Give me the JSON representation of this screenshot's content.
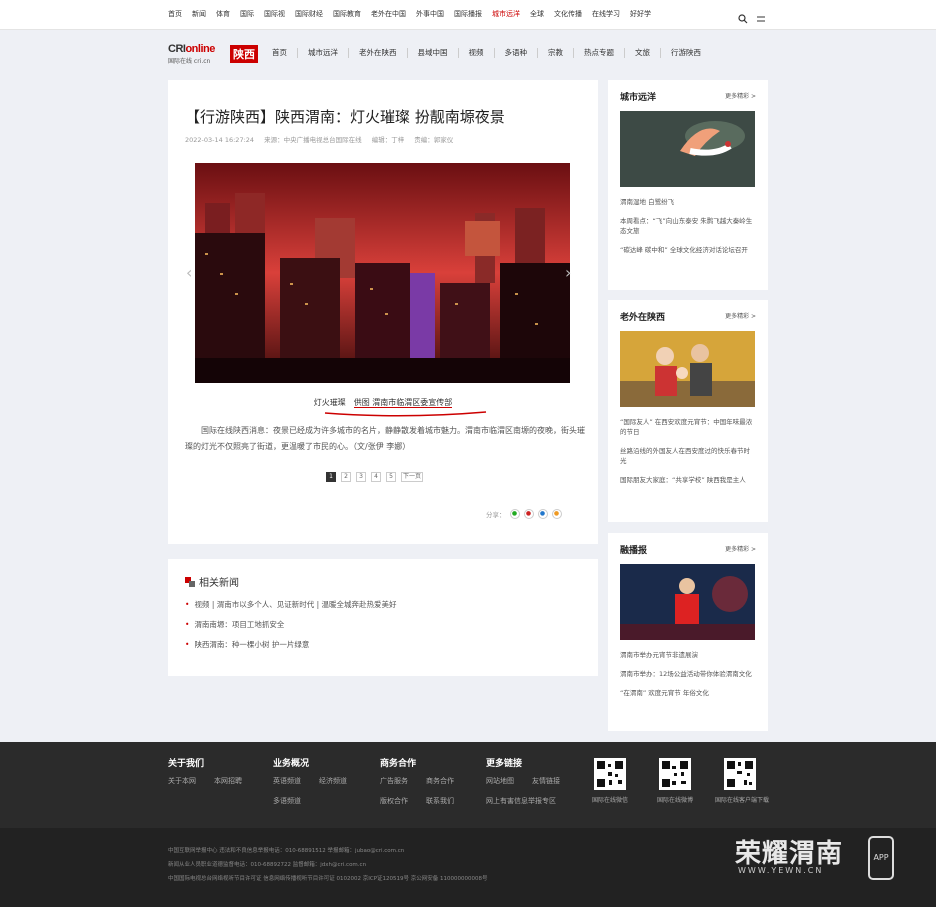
{
  "topnav": [
    "首页",
    "新闻",
    "体育",
    "国际",
    "国际视",
    " 国际财经",
    "国际教育",
    "老外在中国",
    "外事中国",
    "国际播报",
    "城市远洋",
    "全球",
    " 文化传播",
    "在线学习",
    "好好学"
  ],
  "topnav_highlight": 10,
  "logo": {
    "brand_a": "CRI",
    "brand_b": "online",
    "sub": "国际在线 cri.cn",
    "tag": "陕西"
  },
  "mainnav": [
    "首页",
    "城市远洋",
    "老外在陕西",
    "县域中国",
    "视频",
    "多语种",
    "宗教",
    "热点专题",
    "文旅",
    "行游陕西"
  ],
  "article": {
    "title": "【行游陕西】陕西渭南：灯火璀璨 扮靓南塬夜景",
    "date": "2022-03-14 16:27:24",
    "source": "来源：中央广播电视总台国际在线",
    "editor": "编辑：丁梓",
    "reviewer": "责编：郭家仪",
    "caption_prefix": "灯火璀璨",
    "caption_link": "供图 渭南市临渭区委宣传部",
    "body": "国际在线陕西消息：夜景已经成为许多城市的名片，静静散发着城市魅力。渭南市临渭区南塬的夜晚，街头璀璨的灯光不仅照亮了街道，更温暖了市民的心。（文/张伊 李娜）",
    "pages": [
      "1",
      "2",
      "3",
      "4",
      "5",
      "下一页"
    ],
    "share_label": "分享："
  },
  "related": {
    "title": "相关新闻",
    "items": [
      "视频 | 渭南市以多个人、见证新时代 | 温暖全城奔赴热爱美好",
      "渭南南塬：项目工地抓安全",
      "陕西渭南：种一棵小树 护一片绿意"
    ]
  },
  "sidebar": [
    {
      "title": "城市远洋",
      "more": "更多精彩 >",
      "items": [
        "渭南湿地 白鹭纷飞",
        "本周看点：“飞”向山东泰安 朱鹮飞越大秦岭生态文旅",
        "“碳达峰 碳中和” 全球文化经济对话论坛召开"
      ]
    },
    {
      "title": "老外在陕西",
      "more": "更多精彩 >",
      "items": [
        "“国际友人” 在西安欢度元宵节：中国年味最浓的节日",
        "丝路沿线的外国友人在西安度过的快乐春节时光",
        "国际朋友大家庭：“共享学校” 陕西我是主人"
      ]
    },
    {
      "title": "融播报",
      "more": "更多精彩 >",
      "items": [
        "渭南市举办元宵节非遗展演",
        "渭南市举办：12场公益活动带你体验渭南文化",
        "“在渭南” 欢度元宵节 年俗文化"
      ]
    }
  ],
  "footer": {
    "about": {
      "title": "关于我们",
      "links": [
        "关于本网",
        "本网招聘"
      ]
    },
    "biz": {
      "title": "业务概况",
      "links": [
        "英语频道",
        "经济频道",
        "多语频道"
      ]
    },
    "coop": {
      "title": "商务合作",
      "links": [
        "广告服务",
        "商务合作",
        "版权合作",
        "联系我们"
      ]
    },
    "more": {
      "title": "更多链接",
      "links": [
        "网站地图",
        "友情链接",
        "网上有害信息举报专区"
      ]
    },
    "qrs": [
      "国际在线微信",
      "国际在线微博",
      "国际在线客户端下载"
    ]
  },
  "copyright": [
    "中国互联网举报中心 违法和不良信息举报电话：010-68891512 举报邮箱：jubao@cri.com.cn",
    "新闻从业人员职业道德监督电话：010-68892722 监督邮箱：jdxh@cri.com.cn",
    "中国国际电视总台网络视听节目许可证 信息网络传播视听节目许可证 0102002 京ICP证120519号 京公网安备 110000000008号"
  ],
  "watermark": {
    "name": "荣耀渭南",
    "url": "WWW.YEWN.CN",
    "app": "APP"
  }
}
